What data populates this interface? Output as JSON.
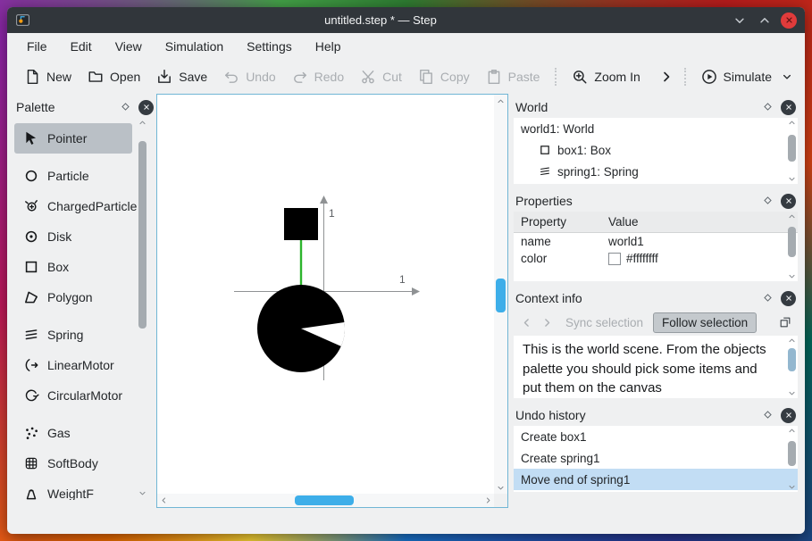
{
  "window": {
    "title": "untitled.step * — Step"
  },
  "menubar": {
    "items": [
      "File",
      "Edit",
      "View",
      "Simulation",
      "Settings",
      "Help"
    ]
  },
  "toolbar": {
    "new": "New",
    "open": "Open",
    "save": "Save",
    "undo": "Undo",
    "redo": "Redo",
    "cut": "Cut",
    "copy": "Copy",
    "paste": "Paste",
    "zoom_in": "Zoom In",
    "simulate": "Simulate"
  },
  "palette": {
    "title": "Palette",
    "items": [
      {
        "label": "Pointer",
        "icon": "pointer-icon",
        "selected": true
      },
      {
        "label": "Particle",
        "icon": "particle-icon",
        "selected": false
      },
      {
        "label": "ChargedParticle",
        "icon": "charged-particle-icon",
        "selected": false
      },
      {
        "label": "Disk",
        "icon": "disk-icon",
        "selected": false
      },
      {
        "label": "Box",
        "icon": "box-icon",
        "selected": false
      },
      {
        "label": "Polygon",
        "icon": "polygon-icon",
        "selected": false
      },
      {
        "label": "Spring",
        "icon": "spring-icon",
        "selected": false
      },
      {
        "label": "LinearMotor",
        "icon": "linear-motor-icon",
        "selected": false
      },
      {
        "label": "CircularMotor",
        "icon": "circular-motor-icon",
        "selected": false
      },
      {
        "label": "Gas",
        "icon": "gas-icon",
        "selected": false
      },
      {
        "label": "SoftBody",
        "icon": "softbody-icon",
        "selected": false
      },
      {
        "label": "WeightF",
        "icon": "weight-icon",
        "selected": false,
        "clipped": true
      }
    ]
  },
  "scene": {
    "x_axis_label": "1",
    "y_axis_label": "1"
  },
  "world_panel": {
    "title": "World",
    "items": [
      {
        "label": "world1: World",
        "indent": 0
      },
      {
        "label": "box1: Box",
        "indent": 1,
        "icon": "box-icon"
      },
      {
        "label": "spring1: Spring",
        "indent": 1,
        "icon": "spring-icon"
      }
    ]
  },
  "properties_panel": {
    "title": "Properties",
    "columns": {
      "property": "Property",
      "value": "Value"
    },
    "rows": [
      {
        "property": "name",
        "value": "world1"
      },
      {
        "property": "color",
        "value": "#ffffffff",
        "swatch": "#ffffff"
      }
    ]
  },
  "context_panel": {
    "title": "Context info",
    "sync_label": "Sync selection",
    "follow_label": "Follow selection",
    "text": "This is the world scene. From the objects palette you should pick some items and put them on the canvas"
  },
  "undo_panel": {
    "title": "Undo history",
    "items": [
      {
        "label": "Create box1",
        "selected": false
      },
      {
        "label": "Create spring1",
        "selected": false
      },
      {
        "label": "Move end of spring1",
        "selected": true
      }
    ]
  },
  "colors": {
    "accent": "#3daee9",
    "selection": "#c2ddf4",
    "titlebar": "#31363b",
    "close_button": "#e03b3b",
    "spring_green": "#2db52d",
    "canvas_border": "#71b6d5"
  }
}
